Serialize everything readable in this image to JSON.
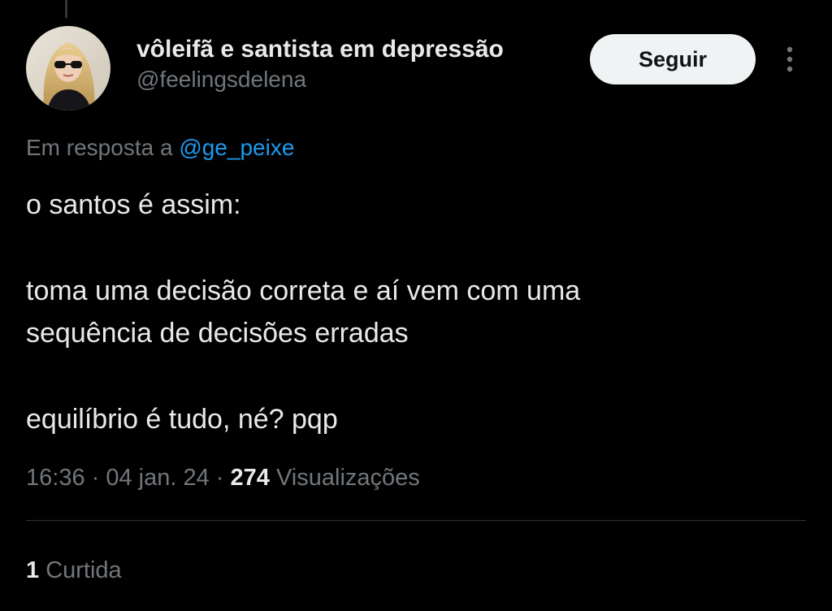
{
  "author": {
    "display_name": "vôleifã e santista em depressão",
    "handle": "@feelingsdelena"
  },
  "follow_button": {
    "label": "Seguir"
  },
  "more_icon": "more-vertical-icon",
  "reply": {
    "prefix": "Em resposta a ",
    "mention": "@ge_peixe"
  },
  "tweet": {
    "lines": [
      "o santos é assim:",
      "toma uma decisão correta e aí vem com uma",
      "sequência de decisões erradas",
      "equilíbrio é tudo, né? pqp"
    ]
  },
  "meta": {
    "time": "16:36",
    "separator": " · ",
    "date": "04 jan. 24",
    "views_count": "274",
    "views_label": " Visualizações"
  },
  "likes": {
    "count": "1",
    "label": " Curtida"
  },
  "colors": {
    "background": "#000000",
    "text_primary": "#e7e9ea",
    "text_secondary": "#71767b",
    "link": "#1d9bf0",
    "button_bg": "#eff3f4",
    "divider": "#2f3336"
  }
}
